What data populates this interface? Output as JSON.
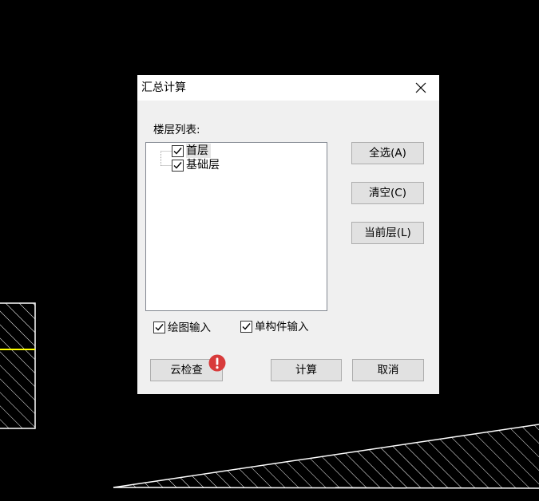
{
  "dialog": {
    "title": "汇总计算",
    "close_icon": "close-icon",
    "floor_list_label": "楼层列表:",
    "floors": [
      {
        "label": "首层",
        "checked": true,
        "selected": true
      },
      {
        "label": "基础层",
        "checked": true,
        "selected": false
      }
    ],
    "buttons": {
      "select_all": "全选(A)",
      "clear": "清空(C)",
      "current_floor": "当前层(L)",
      "cloud_check": "云检查",
      "calculate": "计算",
      "cancel": "取消"
    },
    "options": {
      "drawing_input": {
        "label": "绘图输入",
        "checked": true
      },
      "single_component_input": {
        "label": "单构件输入",
        "checked": true
      }
    },
    "badge_icon": "exclamation-alert-icon"
  },
  "colors": {
    "background": "#000000",
    "cad_lines": "#ffffff",
    "cad_accent": "#ffff00",
    "alert_badge": "#d83b3b"
  }
}
